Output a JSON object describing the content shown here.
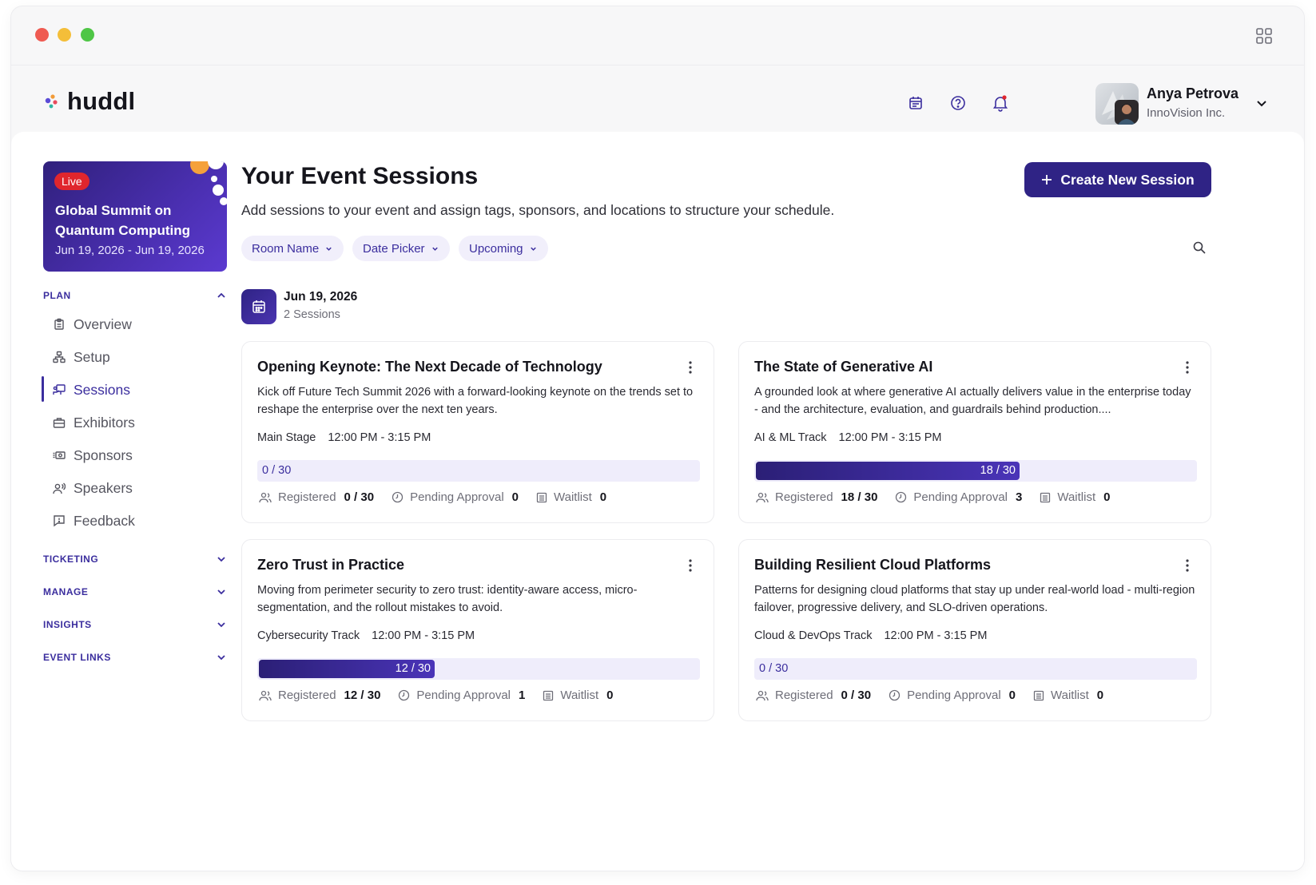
{
  "app": {
    "logo_text": "huddl"
  },
  "user": {
    "name": "Anya Petrova",
    "org": "InnoVision Inc."
  },
  "event": {
    "badge": "Live",
    "title": "Global Summit on Quantum Computing",
    "dates": "Jun 19, 2026 - Jun 19, 2026"
  },
  "sidebar": {
    "plan_label": "PLAN",
    "items": [
      {
        "label": "Overview",
        "icon": "clipboard-icon"
      },
      {
        "label": "Setup",
        "icon": "hierarchy-icon"
      },
      {
        "label": "Sessions",
        "icon": "presentation-icon"
      },
      {
        "label": "Exhibitors",
        "icon": "briefcase-icon"
      },
      {
        "label": "Sponsors",
        "icon": "money-icon"
      },
      {
        "label": "Speakers",
        "icon": "speaker-icon"
      },
      {
        "label": "Feedback",
        "icon": "feedback-icon"
      }
    ],
    "sections": [
      "TICKETING",
      "MANAGE",
      "INSIGHTS",
      "EVENT LINKS"
    ]
  },
  "page": {
    "title": "Your Event Sessions",
    "subtitle": "Add sessions to your event and assign tags, sponsors, and locations to structure your schedule.",
    "create_label": "Create New Session",
    "filters": [
      "Room Name",
      "Date Picker",
      "Upcoming"
    ]
  },
  "day": {
    "date": "Jun 19, 2026",
    "count": "2 Sessions"
  },
  "stat_labels": {
    "registered": "Registered",
    "pending": "Pending Approval",
    "waitlist": "Waitlist"
  },
  "sessions": [
    {
      "title": "Opening Keynote: The Next Decade of Technology",
      "desc": "Kick off Future Tech Summit 2026 with a forward-looking keynote on the trends set to reshape the enterprise over the next ten years.",
      "room": "Main Stage",
      "time": "12:00 PM - 3:15 PM",
      "capacity_label": "0 / 30",
      "fill_fraction": 0,
      "registered": "0 / 30",
      "pending": "0",
      "waitlist": "0"
    },
    {
      "title": "The State of Generative AI",
      "desc": "A grounded look at where generative AI actually delivers value in the enterprise today - and the architecture, evaluation, and guardrails behind production....",
      "room": "AI & ML Track",
      "time": "12:00 PM - 3:15 PM",
      "capacity_label": "18 / 30",
      "fill_fraction": 0.6,
      "registered": "18 / 30",
      "pending": "3",
      "waitlist": "0"
    },
    {
      "title": "Zero Trust in Practice",
      "desc": "Moving from perimeter security to zero trust: identity-aware access, micro-segmentation, and the rollout mistakes to avoid.",
      "room": "Cybersecurity Track",
      "time": "12:00 PM - 3:15 PM",
      "capacity_label": "12 / 30",
      "fill_fraction": 0.4,
      "registered": "12 / 30",
      "pending": "1",
      "waitlist": "0"
    },
    {
      "title": "Building Resilient Cloud Platforms",
      "desc": "Patterns for designing cloud platforms that stay up under real-world load - multi-region failover, progressive delivery, and SLO-driven operations.",
      "room": "Cloud & DevOps Track",
      "time": "12:00 PM - 3:15 PM",
      "capacity_label": "0 / 30",
      "fill_fraction": 0,
      "registered": "0 / 30",
      "pending": "0",
      "waitlist": "0"
    }
  ],
  "colors": {
    "accent": "#3b2e9e",
    "button": "#2f2385",
    "live": "#e0262d"
  }
}
